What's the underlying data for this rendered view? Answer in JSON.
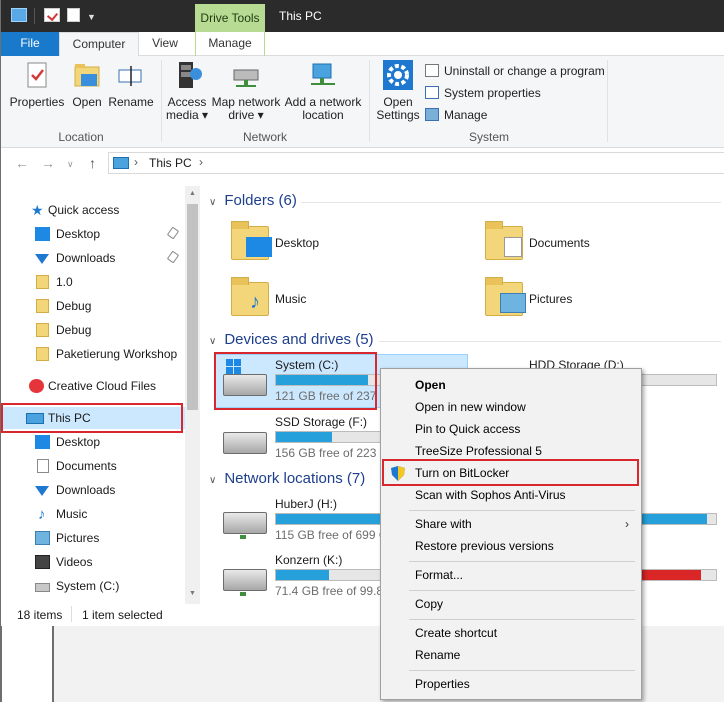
{
  "titlebar": {
    "contextual_tab": "Drive Tools",
    "title": "This PC"
  },
  "tabs": {
    "file": "File",
    "computer": "Computer",
    "view": "View",
    "manage": "Manage"
  },
  "ribbon": {
    "location": {
      "label": "Location",
      "properties": "Properties",
      "open": "Open",
      "rename": "Rename"
    },
    "network": {
      "label": "Network",
      "access_media_1": "Access",
      "access_media_2": "media ▾",
      "map_drive_1": "Map network",
      "map_drive_2": "drive ▾",
      "add_location_1": "Add a network",
      "add_location_2": "location"
    },
    "system": {
      "label": "System",
      "open_settings_1": "Open",
      "open_settings_2": "Settings",
      "uninstall": "Uninstall or change a program",
      "system_properties": "System properties",
      "manage": "Manage"
    }
  },
  "address": {
    "path": "This PC"
  },
  "nav": {
    "quick_access": "Quick access",
    "items": [
      {
        "label": "Desktop",
        "pinned": true
      },
      {
        "label": "Downloads",
        "pinned": true
      },
      {
        "label": "1.0"
      },
      {
        "label": "Debug"
      },
      {
        "label": "Debug"
      },
      {
        "label": "Paketierung Workshop"
      }
    ],
    "creative_cloud": "Creative Cloud Files",
    "this_pc": "This PC",
    "pc_items": [
      "Desktop",
      "Documents",
      "Downloads",
      "Music",
      "Pictures",
      "Videos",
      "System (C:)"
    ]
  },
  "content": {
    "folders_header": "Folders (6)",
    "folders": [
      "Desktop",
      "Documents",
      "Music",
      "Pictures"
    ],
    "devices_header": "Devices and drives (5)",
    "drives": [
      {
        "name": "System (C:)",
        "free": "121 GB free of 237 GB",
        "used": 0.49
      },
      {
        "name": "HDD Storage (D:)",
        "used": 0.55
      },
      {
        "name": "SSD Storage (F:)",
        "free": "156 GB free of 223 GB",
        "used": 0.3
      }
    ],
    "network_header": "Network locations (7)",
    "network": [
      {
        "name": "HuberJ (H:)",
        "free": "115 GB free of 699 GB",
        "used": 0.84,
        "right_used": 0.95
      },
      {
        "name": "Konzern (K:)",
        "free": "71.4 GB free of 99.8 GB",
        "used": 0.28,
        "right_used": 0.92
      }
    ]
  },
  "status": {
    "items": "18 items",
    "selected": "1 item selected"
  },
  "context_menu": {
    "open": "Open",
    "open_new_window": "Open in new window",
    "pin_quick_access": "Pin to Quick access",
    "treesize": "TreeSize Professional 5",
    "bitlocker": "Turn on BitLocker",
    "sophos": "Scan with Sophos Anti-Virus",
    "share_with": "Share with",
    "restore": "Restore previous versions",
    "format": "Format...",
    "copy": "Copy",
    "create_shortcut": "Create shortcut",
    "rename": "Rename",
    "properties": "Properties"
  },
  "colors": {
    "accent": "#1979ca",
    "drive_tools": "#b7db93",
    "selection": "#cce8ff",
    "highlight_box": "#d9272e",
    "bar_fill": "#26a0da",
    "bar_full": "#da2626"
  }
}
